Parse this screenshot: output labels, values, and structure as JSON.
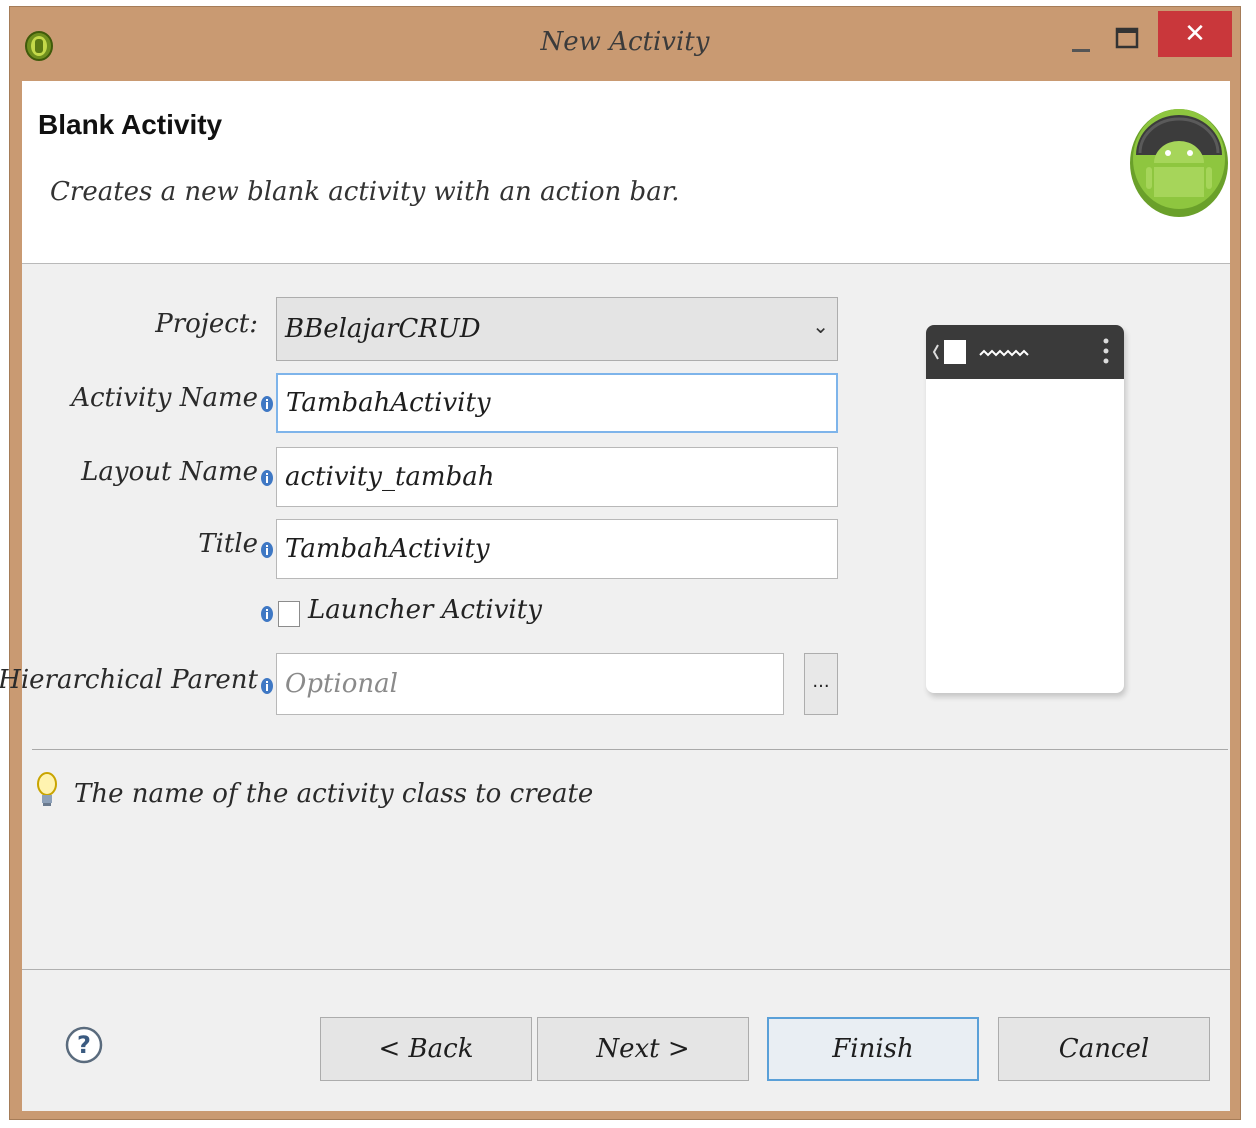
{
  "window": {
    "title": "New Activity",
    "close_glyph": "✕"
  },
  "header": {
    "title": "Blank Activity",
    "description": "Creates a new blank activity with an action bar."
  },
  "form": {
    "project": {
      "label": "Project:",
      "value": "BBelajarCRUD"
    },
    "activity_name": {
      "label": "Activity Name",
      "value": "TambahActivity"
    },
    "layout_name": {
      "label": "Layout Name",
      "value": "activity_tambah"
    },
    "title": {
      "label": "Title",
      "value": "TambahActivity"
    },
    "launcher_activity": {
      "label": "Launcher Activity",
      "checked": false
    },
    "hierarchical_parent": {
      "label": "Hierarchical Parent",
      "placeholder": "Optional",
      "browse_label": "..."
    }
  },
  "hint": {
    "text": "The name of the activity class to create"
  },
  "buttons": {
    "back": "< Back",
    "next": "Next >",
    "finish": "Finish",
    "cancel": "Cancel"
  },
  "icons": [
    "eclipse-app-icon",
    "android-logo-icon",
    "info-icon",
    "lightbulb-icon",
    "help-icon"
  ],
  "colors": {
    "frame": "#c99a72",
    "close_button": "#c9373b",
    "focus_border": "#7eb4ea",
    "android_green": "#8ec63f"
  }
}
